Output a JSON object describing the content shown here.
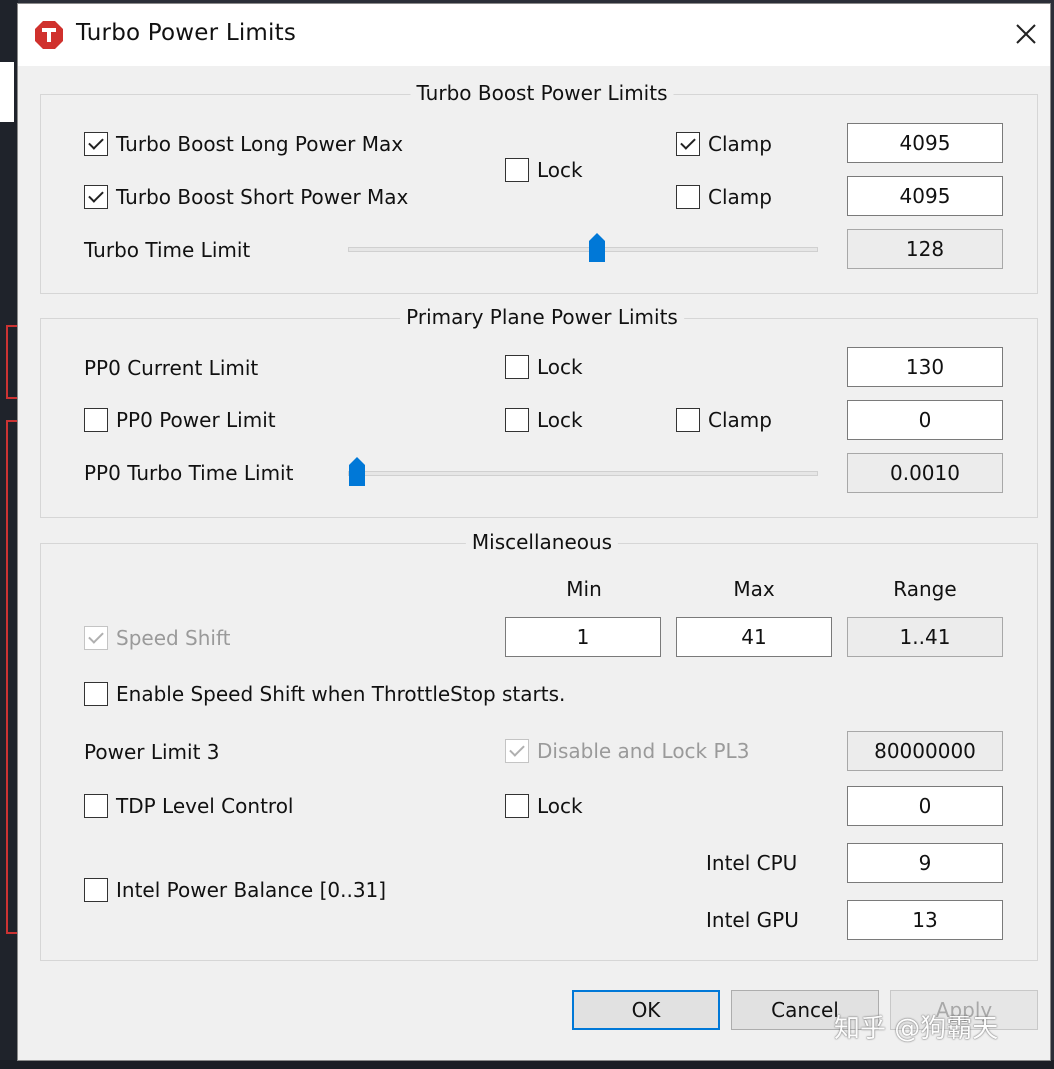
{
  "window": {
    "title": "Turbo Power Limits",
    "close_glyph": "✕"
  },
  "turbo_boost": {
    "title": "Turbo Boost Power Limits",
    "long_power_max": {
      "label": "Turbo Boost Long Power Max",
      "checked": true,
      "clamp_label": "Clamp",
      "clamp_checked": true,
      "value": "4095"
    },
    "short_power_max": {
      "label": "Turbo Boost Short Power Max",
      "checked": true,
      "clamp_label": "Clamp",
      "clamp_checked": false,
      "value": "4095"
    },
    "lock_label": "Lock",
    "lock_checked": false,
    "time_limit": {
      "label": "Turbo Time Limit",
      "value": "128",
      "slider_fraction": 0.53
    }
  },
  "primary_plane": {
    "title": "Primary Plane Power Limits",
    "current_limit": {
      "label": "PP0 Current Limit",
      "lock_label": "Lock",
      "lock_checked": false,
      "value": "130"
    },
    "power_limit": {
      "label": "PP0 Power Limit",
      "checked": false,
      "lock_label": "Lock",
      "lock_checked": false,
      "clamp_label": "Clamp",
      "clamp_checked": false,
      "value": "0"
    },
    "turbo_time_limit": {
      "label": "PP0 Turbo Time Limit",
      "value": "0.0010",
      "slider_fraction": 0.02
    }
  },
  "misc": {
    "title": "Miscellaneous",
    "col_min": "Min",
    "col_max": "Max",
    "col_range": "Range",
    "speed_shift": {
      "label": "Speed Shift",
      "checked": true,
      "disabled": true,
      "min": "1",
      "max": "41",
      "range": "1..41"
    },
    "enable_speed_shift": {
      "label": "Enable Speed Shift when ThrottleStop starts.",
      "checked": false
    },
    "power_limit_3": {
      "label": "Power Limit 3",
      "disable_lock_label": "Disable and Lock PL3",
      "disable_lock_checked": true,
      "value": "80000000"
    },
    "tdp_level": {
      "label": "TDP Level Control",
      "checked": false,
      "lock_label": "Lock",
      "lock_checked": false,
      "value": "0"
    },
    "power_balance": {
      "label": "Intel Power Balance  [0..31]",
      "checked": false,
      "cpu_label": "Intel CPU",
      "cpu_value": "9",
      "gpu_label": "Intel GPU",
      "gpu_value": "13"
    }
  },
  "buttons": {
    "ok": "OK",
    "cancel": "Cancel",
    "apply": "Apply"
  },
  "watermark": "知乎 @狗霸天",
  "colors": {
    "accent": "#0078d7",
    "app_icon": "#d0312d"
  }
}
